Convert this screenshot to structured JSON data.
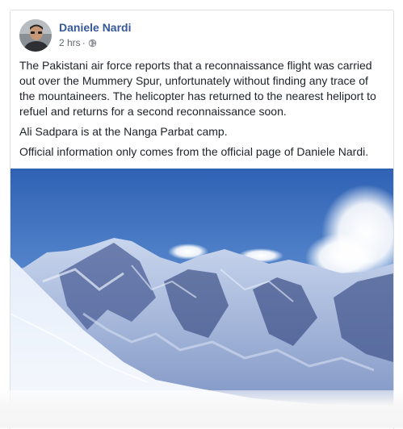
{
  "post": {
    "author": "Daniele Nardi",
    "timestamp": "2 hrs",
    "separator": "·",
    "privacy_icon": "globe-icon",
    "paragraphs": [
      "The Pakistani air force reports that a reconnaissance flight was carried out over the Mummery Spur, unfortunately without finding any trace of the mountaineers. The helicopter has returned to the nearest heliport to refuel and returns for a second reconnaissance soon.",
      "Ali Sadpara is at the Nanga Parbat camp.",
      "Official information only comes from the official page of Daniele Nardi."
    ]
  },
  "colors": {
    "author_link": "#365899",
    "text": "#1d2129",
    "meta": "#616770",
    "border": "#dddfe2"
  }
}
